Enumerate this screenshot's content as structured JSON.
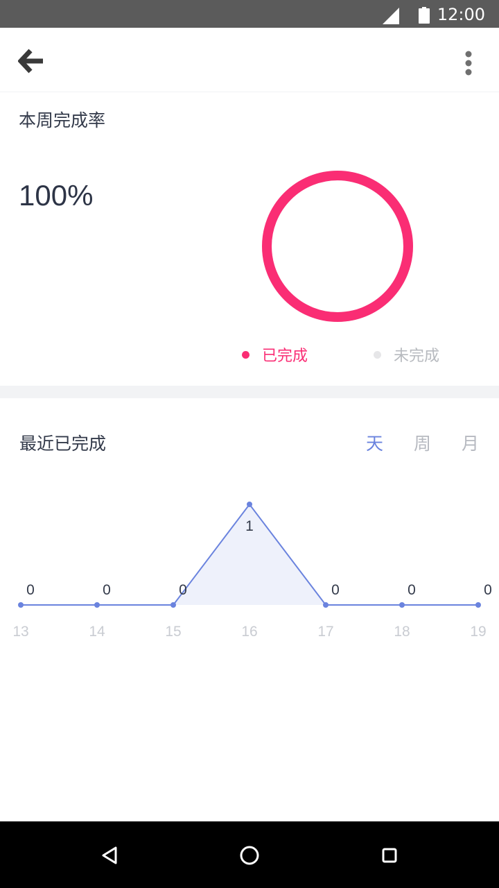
{
  "status_bar": {
    "time": "12:00",
    "icons": [
      "signal-icon",
      "battery-icon"
    ]
  },
  "app_bar": {
    "back_icon": "arrow-left-icon",
    "menu_icon": "more-vert-icon"
  },
  "weekly_completion": {
    "title": "本周完成率",
    "percent_text": "100%",
    "completion_rate": 1.0,
    "legend": [
      {
        "label": "已完成",
        "color": "#fa2d74"
      },
      {
        "label": "未完成",
        "color": "#e6e6e8"
      }
    ]
  },
  "recent_completed": {
    "title": "最近已完成",
    "range_tabs": [
      {
        "label": "天",
        "active": true
      },
      {
        "label": "周",
        "active": false
      },
      {
        "label": "月",
        "active": false
      }
    ]
  },
  "colors": {
    "accent": "#6a83de",
    "pink": "#fa2d74",
    "tab_inactive": "#b6b9c0",
    "tick": "#c9ccd2",
    "label": "#2d3446"
  },
  "chart_data": {
    "type": "area",
    "categories": [
      "13",
      "14",
      "15",
      "16",
      "17",
      "18",
      "19"
    ],
    "values": [
      0,
      0,
      0,
      1,
      0,
      0,
      0
    ],
    "xlabel": "",
    "ylabel": "",
    "grid": false,
    "legend": "none",
    "data_labels": true
  },
  "nav_bar": {
    "icons": [
      "back-triangle-icon",
      "home-circle-icon",
      "recents-square-icon"
    ]
  }
}
